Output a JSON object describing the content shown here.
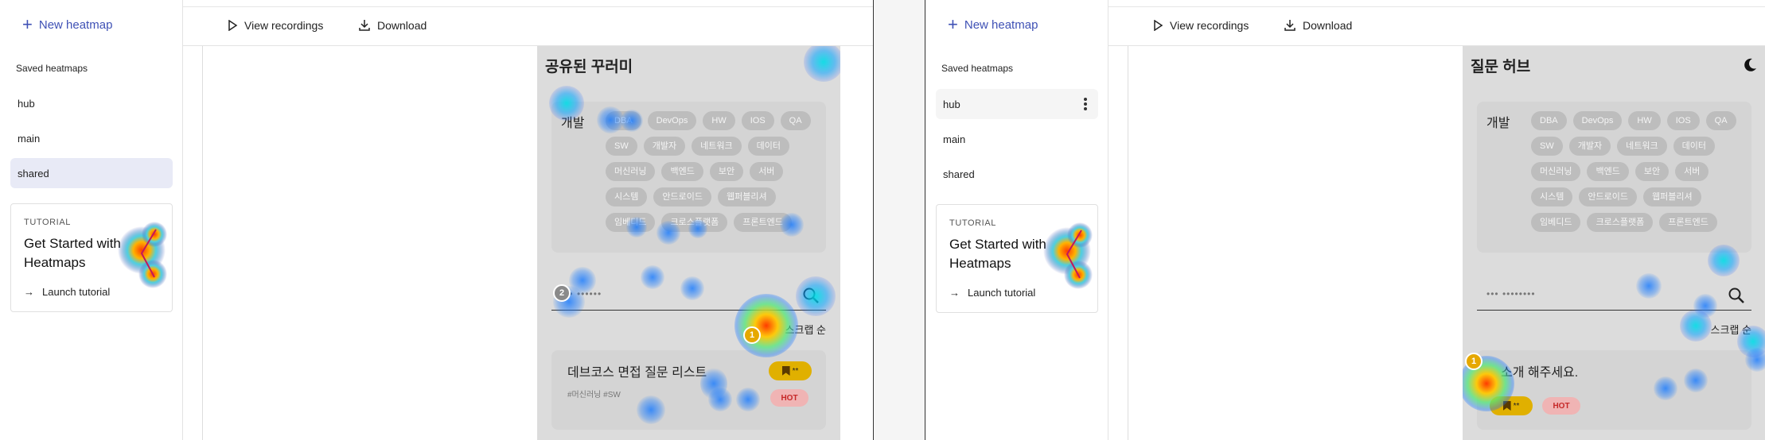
{
  "panels": [
    {
      "sidebar": {
        "new_heatmap": "New heatmap",
        "saved_title": "Saved heatmaps",
        "items": [
          {
            "label": "hub",
            "state": "normal"
          },
          {
            "label": "main",
            "state": "normal"
          },
          {
            "label": "shared",
            "state": "selected"
          }
        ],
        "tutorial": {
          "label": "TUTORIAL",
          "heading": "Get Started with Heatmaps",
          "link": "Launch tutorial"
        }
      },
      "toolbar": {
        "view_recordings": "View recordings",
        "download": "Download"
      },
      "preview": {
        "title": "공유된 꾸러미",
        "category_label": "개발",
        "chips": [
          "DBA",
          "DevOps",
          "HW",
          "IOS",
          "QA",
          "SW",
          "개발자",
          "네트워크",
          "데이터",
          "머신러닝",
          "백엔드",
          "보안",
          "서버",
          "시스템",
          "안드로이드",
          "웹퍼블리셔",
          "임베디드",
          "크로스플랫폼",
          "프론트엔드"
        ],
        "search_placeholder": "••• ••••••",
        "sort_label": "스크랩 순",
        "card": {
          "title": "데브코스 면접 질문 리스트",
          "tags": "#머신러닝 #SW",
          "scrap_badge": "**",
          "hot_badge": "HOT"
        },
        "markers": [
          "2",
          "1"
        ]
      }
    },
    {
      "sidebar": {
        "new_heatmap": "New heatmap",
        "saved_title": "Saved heatmaps",
        "items": [
          {
            "label": "hub",
            "state": "hover"
          },
          {
            "label": "main",
            "state": "normal"
          },
          {
            "label": "shared",
            "state": "normal"
          }
        ],
        "tutorial": {
          "label": "TUTORIAL",
          "heading": "Get Started with Heatmaps",
          "link": "Launch tutorial"
        }
      },
      "toolbar": {
        "view_recordings": "View recordings",
        "download": "Download"
      },
      "preview": {
        "title": "질문 허브",
        "category_label": "개발",
        "chips": [
          "DBA",
          "DevOps",
          "HW",
          "IOS",
          "QA",
          "SW",
          "개발자",
          "네트워크",
          "데이터",
          "머신러닝",
          "백엔드",
          "보안",
          "서버",
          "시스템",
          "안드로이드",
          "웹퍼블리셔",
          "임베디드",
          "크로스플랫폼",
          "프론트엔드"
        ],
        "search_placeholder": "••• ••••••••",
        "sort_label": "스크랩 순",
        "card": {
          "title": "소개 해주세요.",
          "scrap_badge": "**",
          "hot_badge": "HOT"
        },
        "markers": [
          "1"
        ]
      }
    }
  ],
  "colors": {
    "accent": "#3f51b5",
    "selected_bg": "#e8eaf6",
    "badge_gold": "#e0b000",
    "badge_hot": "#f0b4b4"
  }
}
